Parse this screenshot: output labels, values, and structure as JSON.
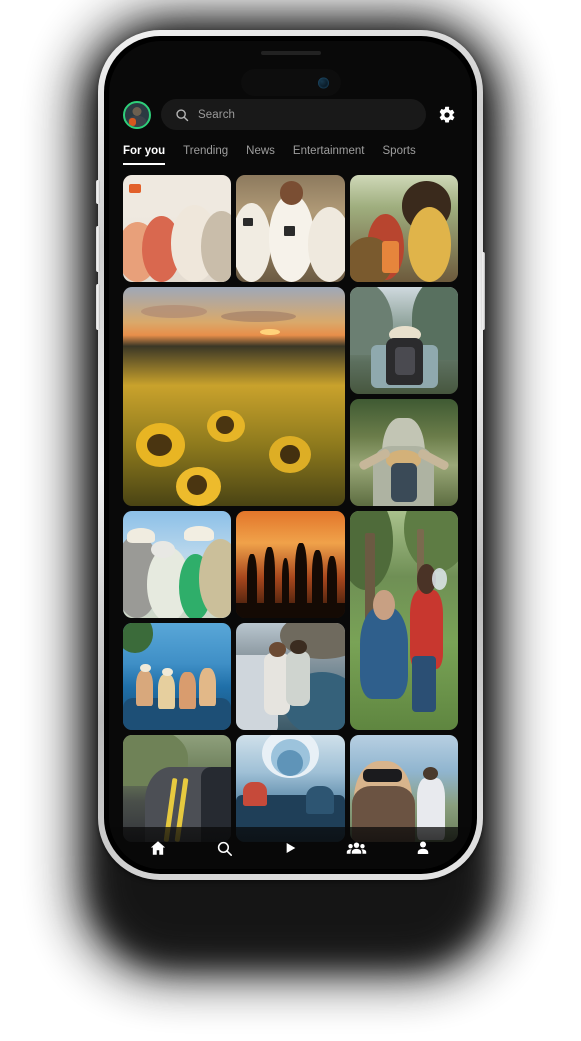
{
  "device": {
    "type": "smartphone-mockup",
    "frame_color": "#dcdcdc",
    "screen_background": "#090909"
  },
  "app": {
    "theme": "dark",
    "accent_color": "#ffffff",
    "avatar": {
      "name": "profile-avatar",
      "ring_color": "#2ecf7a"
    },
    "search": {
      "placeholder": "Search",
      "value": "",
      "icon": "search-icon",
      "background": "#191919"
    },
    "settings": {
      "icon": "gear-icon",
      "label": "Settings"
    },
    "tabs": [
      {
        "label": "For you",
        "active": true
      },
      {
        "label": "Trending",
        "active": false
      },
      {
        "label": "News",
        "active": false
      },
      {
        "label": "Entertainment",
        "active": false
      },
      {
        "label": "Sports",
        "active": false
      }
    ],
    "feed": {
      "layout": "masonry-3-column",
      "tiles": [
        {
          "id": "friends-group",
          "alt": "Group of friends laughing together outdoors",
          "col_span": 1,
          "row_span": 2,
          "art": "a-friends"
        },
        {
          "id": "volleyball-team",
          "alt": "Three smiling volleyball players in jerseys",
          "col_span": 1,
          "row_span": 2,
          "art": "a-volley"
        },
        {
          "id": "garden-party",
          "alt": "Friends toasting drinks at a garden party",
          "col_span": 1,
          "row_span": 2,
          "art": "a-party"
        },
        {
          "id": "sunflower-field",
          "alt": "Sunflower field at sunset",
          "col_span": 2,
          "row_span": 4,
          "art": "a-sunflower"
        },
        {
          "id": "mountain-hiker",
          "alt": "Hiker with backpack facing mountain river",
          "col_span": 1,
          "row_span": 2,
          "art": "a-hiker"
        },
        {
          "id": "suspension-bridge",
          "alt": "Woman with arms raised on suspension bridge",
          "col_span": 1,
          "row_span": 2,
          "art": "a-bridge"
        },
        {
          "id": "senior-friends",
          "alt": "Senior friends in sun hats at the beach",
          "col_span": 1,
          "row_span": 2,
          "art": "a-seniors"
        },
        {
          "id": "beach-dance",
          "alt": "Silhouettes dancing on beach at sunset",
          "col_span": 1,
          "row_span": 2,
          "art": "a-dance"
        },
        {
          "id": "park-frisbee",
          "alt": "People playing frisbee in a sunny park",
          "col_span": 1,
          "row_span": 4,
          "art": "a-frisbee"
        },
        {
          "id": "convertible-trip",
          "alt": "Friends cheering in a convertible by the sea",
          "col_span": 1,
          "row_span": 2,
          "art": "a-cabrio"
        },
        {
          "id": "coastal-couple",
          "alt": "Couple relaxing on a car at the coast",
          "col_span": 1,
          "row_span": 2,
          "art": "a-coast"
        },
        {
          "id": "mountain-road",
          "alt": "Car driving a winding mountain road",
          "col_span": 1,
          "row_span": 2,
          "art": "a-road"
        },
        {
          "id": "train-interior",
          "alt": "Interior of a modern train carriage",
          "col_span": 1,
          "row_span": 2,
          "art": "a-train"
        },
        {
          "id": "sunglasses-portrait",
          "alt": "Woman in sunglasses smiling outdoors",
          "col_span": 1,
          "row_span": 2,
          "art": "a-portrait"
        }
      ]
    },
    "bottom_nav": [
      {
        "id": "home",
        "icon": "home-icon",
        "label": "Home",
        "active": true
      },
      {
        "id": "search",
        "icon": "search-icon",
        "label": "Search",
        "active": false
      },
      {
        "id": "reels",
        "icon": "play-icon",
        "label": "Reels",
        "active": false
      },
      {
        "id": "groups",
        "icon": "people-icon",
        "label": "Groups",
        "active": false
      },
      {
        "id": "profile",
        "icon": "person-icon",
        "label": "Profile",
        "active": false
      }
    ]
  }
}
